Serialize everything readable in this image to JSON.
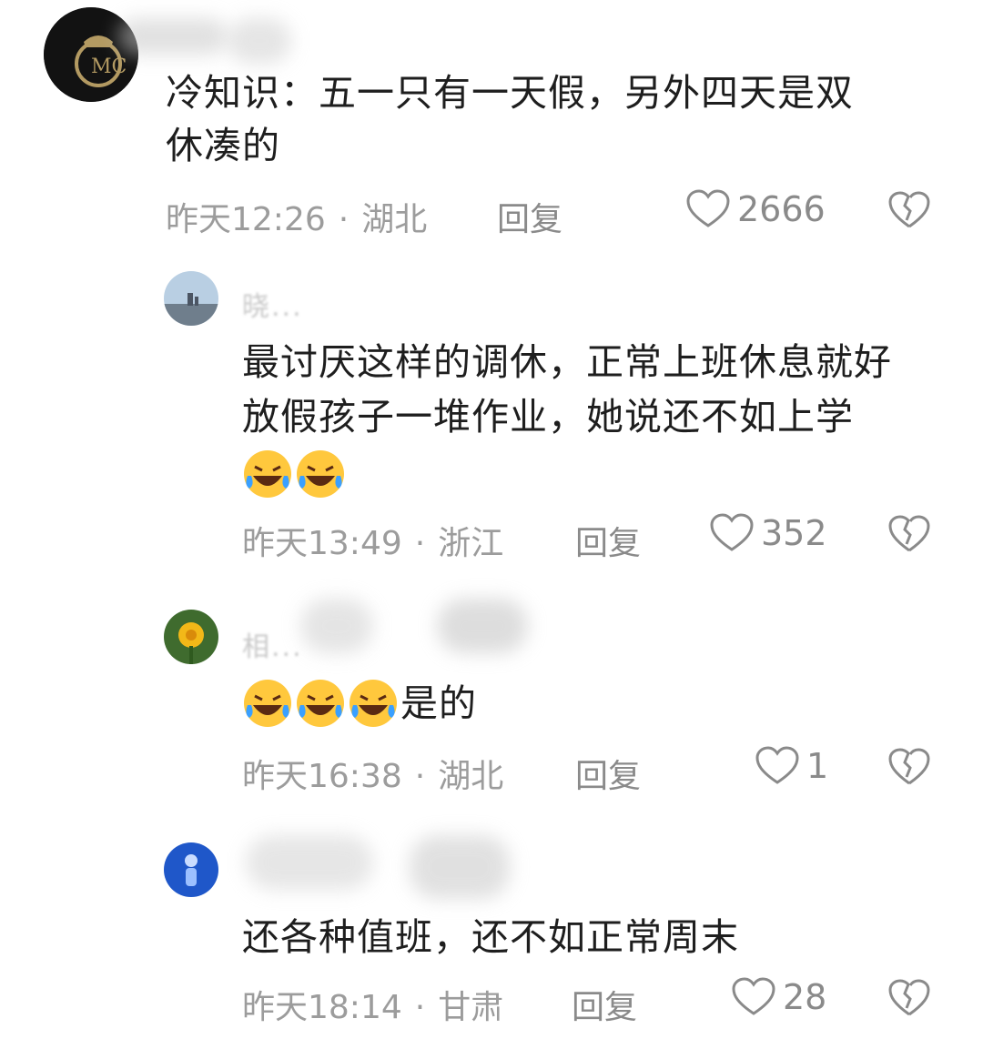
{
  "comments": [
    {
      "username": "",
      "text_lines": [
        "冷知识：五一只有一天假，另外四天是双",
        "休凑的"
      ],
      "emoji_count": 0,
      "emoji_suffix": "",
      "time": "昨天12:26",
      "location": "湖北",
      "reply_label": "回复",
      "likes": "2666",
      "avatar_icon": "real-madrid-crest-avatar"
    },
    {
      "username": "晓...",
      "text_lines": [
        "最讨厌这样的调休，正常上班休息就好",
        "放假孩子一堆作业，她说还不如上学"
      ],
      "emoji_count": 2,
      "emoji_suffix": "",
      "time": "昨天13:49",
      "location": "浙江",
      "reply_label": "回复",
      "likes": "352",
      "avatar_icon": "landscape-avatar"
    },
    {
      "username": "相...",
      "text_lines": [],
      "emoji_count": 3,
      "emoji_suffix": "是的",
      "time": "昨天16:38",
      "location": "湖北",
      "reply_label": "回复",
      "likes": "1",
      "avatar_icon": "yellow-flower-avatar"
    },
    {
      "username": "",
      "text_lines": [
        "还各种值班，还不如正常周末"
      ],
      "emoji_count": 0,
      "emoji_suffix": "",
      "time": "昨天18:14",
      "location": "甘肃",
      "reply_label": "回复",
      "likes": "28",
      "avatar_icon": "blue-figure-avatar"
    }
  ],
  "colors": {
    "text": "#1e1e1e",
    "meta": "#9c9c9c",
    "emoji_face": "#ffc83d",
    "emoji_tear": "#3aa0ff"
  }
}
